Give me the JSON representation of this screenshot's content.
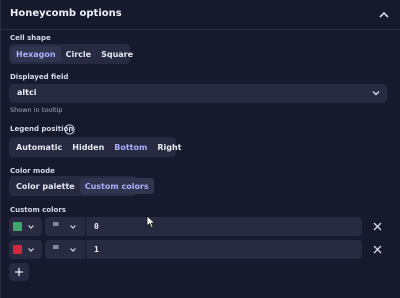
{
  "panel": {
    "title": "Honeycomb options",
    "collapse_icon": "chevron-up-icon"
  },
  "cell_shape": {
    "label": "Cell shape",
    "options": [
      "Hexagon",
      "Circle",
      "Square"
    ],
    "selected": "Hexagon"
  },
  "displayed_field": {
    "label": "Displayed field",
    "value": "altci",
    "hint": "Shown in tooltip",
    "icon": "chevron-down-icon"
  },
  "legend_position": {
    "label": "Legend position",
    "info_icon": "info-icon",
    "options": [
      "Automatic",
      "Hidden",
      "Bottom",
      "Right"
    ],
    "selected": "Bottom"
  },
  "color_mode": {
    "label": "Color mode",
    "options": [
      "Color palette",
      "Custom colors"
    ],
    "selected": "Custom colors"
  },
  "custom_colors": {
    "label": "Custom colors",
    "rows": [
      {
        "color": "#3fa56b",
        "operator": "=",
        "value": "0"
      },
      {
        "color": "#d3283a",
        "operator": "=",
        "value": "1"
      }
    ],
    "add_icon": "plus-icon",
    "remove_icon": "close-icon"
  },
  "colors": {
    "accent": "#a9b1ff",
    "background": "#171a2d",
    "control": "#272a40"
  }
}
